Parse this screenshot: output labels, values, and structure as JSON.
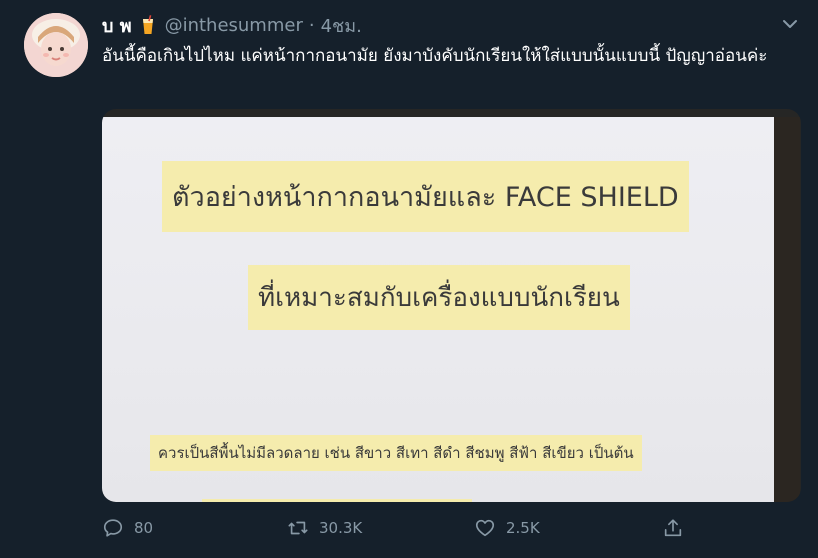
{
  "tweet": {
    "display_name": "บ พ",
    "handle": "@inthesummer",
    "separator": "·",
    "time": "4ชม.",
    "text": "อันนี้คือเกินไปไหม แค่หน้ากากอนามัย ยังมาบังคับนักเรียนให้ใส่แบบนั้นแบบนี้ ปัญญาอ่อนค่ะ",
    "media": {
      "sign_line1": "ตัวอย่างหน้ากากอนามัยและ FACE SHIELD",
      "sign_line2": "ที่เหมาะสมกับเครื่องแบบนักเรียน",
      "sign_line3": "ควรเป็นสีพื้นไม่มีลวดลาย เช่น สีขาว สีเทา สีดำ สีชมพู สีฟ้า สีเขียว เป็นต้น"
    }
  },
  "actions": {
    "reply_count": "80",
    "retweet_count": "30.3K",
    "like_count": "2.5K"
  },
  "icons": {
    "menu": "chevron-down-icon",
    "reply": "reply-icon",
    "retweet": "retweet-icon",
    "like": "heart-icon",
    "share": "share-icon",
    "badge": "drink-emoji-icon"
  },
  "colors": {
    "background": "#15202b",
    "secondary_text": "#8899a6",
    "primary_text": "#ffffff"
  }
}
